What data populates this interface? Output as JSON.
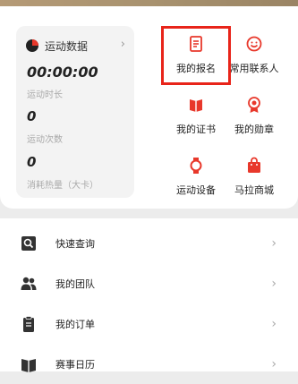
{
  "stats": {
    "title": "运动数据",
    "icon": "pie-chart-icon",
    "chevron": "›",
    "duration_value": "00:00:00",
    "duration_label": "运动时长",
    "count_value": "0",
    "count_label": "运动次数",
    "calories_value": "0",
    "calories_label": "消耗热量（大卡）"
  },
  "grid": {
    "accent_color": "#e8382b",
    "items": [
      {
        "label": "我的报名",
        "icon": "registration-icon"
      },
      {
        "label": "常用联系人",
        "icon": "contact-icon"
      },
      {
        "label": "我的证书",
        "icon": "certificate-icon"
      },
      {
        "label": "我的勋章",
        "icon": "medal-icon"
      },
      {
        "label": "运动设备",
        "icon": "watch-icon"
      },
      {
        "label": "马拉商城",
        "icon": "shopping-bag-icon"
      }
    ]
  },
  "list": {
    "items": [
      {
        "label": "快速查询",
        "icon": "quick-search-icon"
      },
      {
        "label": "我的团队",
        "icon": "team-icon"
      },
      {
        "label": "我的订单",
        "icon": "clipboard-icon"
      },
      {
        "label": "赛事日历",
        "icon": "calendar-book-icon"
      }
    ],
    "chevron": "›"
  }
}
